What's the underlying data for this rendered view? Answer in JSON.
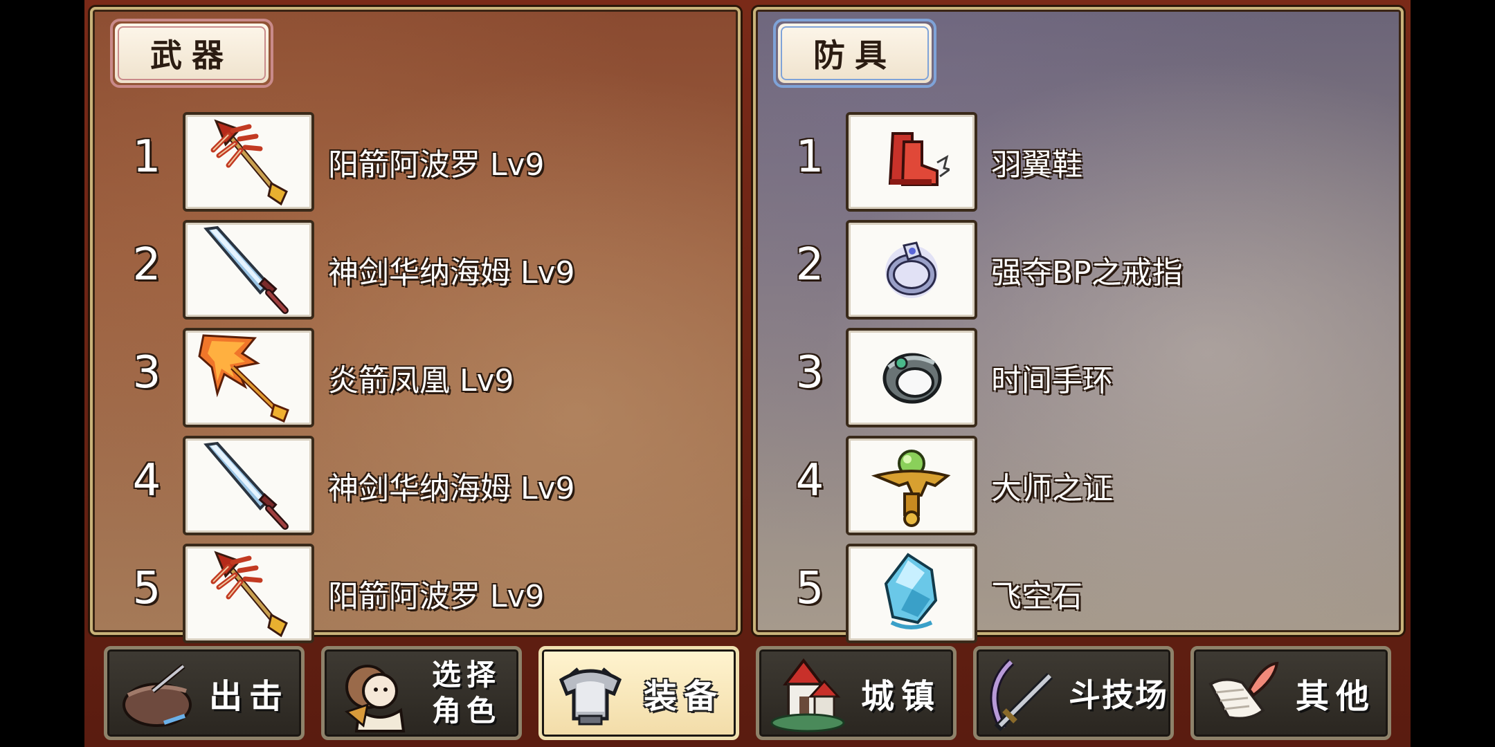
{
  "weapons": {
    "title": "武器",
    "items": [
      {
        "index": "1",
        "name": "阳箭阿波罗 Lv9",
        "icon": "sun-arrow-icon"
      },
      {
        "index": "2",
        "name": "神剑华纳海姆 Lv9",
        "icon": "holy-sword-icon"
      },
      {
        "index": "3",
        "name": "炎箭凤凰 Lv9",
        "icon": "flame-arrow-icon"
      },
      {
        "index": "4",
        "name": "神剑华纳海姆 Lv9",
        "icon": "holy-sword-icon"
      },
      {
        "index": "5",
        "name": "阳箭阿波罗 Lv9",
        "icon": "sun-arrow-icon"
      }
    ]
  },
  "armor": {
    "title": "防具",
    "items": [
      {
        "index": "1",
        "name": "羽翼鞋",
        "icon": "winged-boots-icon"
      },
      {
        "index": "2",
        "name": "强夺BP之戒指",
        "icon": "ring-icon"
      },
      {
        "index": "3",
        "name": "时间手环",
        "icon": "bracelet-icon"
      },
      {
        "index": "4",
        "name": "大师之证",
        "icon": "master-emblem-icon"
      },
      {
        "index": "5",
        "name": "飞空石",
        "icon": "sky-stone-icon"
      }
    ]
  },
  "nav": {
    "sortie": "出击",
    "select_character": "选择\n角色",
    "equipment": "装备",
    "town": "城镇",
    "arena": "斗技场",
    "other": "其他",
    "active": "equipment"
  },
  "colors": {
    "panel_border": "#c9b37a",
    "weapon_tag_border": "#c98a8a",
    "armor_tag_border": "#7fa3d8",
    "active_button": "#f2dca8"
  }
}
